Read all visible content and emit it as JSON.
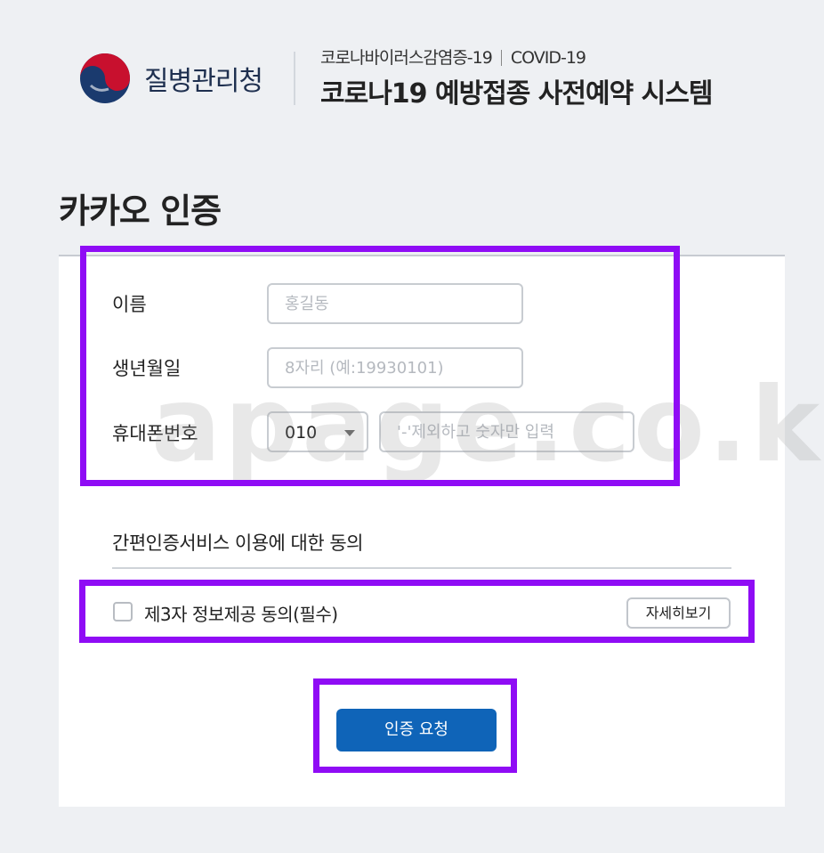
{
  "header": {
    "org_name": "질병관리청",
    "subtitle_left": "코로나바이러스감염증-19",
    "subtitle_right": "COVID-19",
    "title": "코로나19 예방접종 사전예약 시스템"
  },
  "page": {
    "heading": "카카오 인증"
  },
  "form": {
    "name_label": "이름",
    "name_placeholder": "홍길동",
    "birth_label": "생년월일",
    "birth_placeholder": "8자리 (예:19930101)",
    "phone_label": "휴대폰번호",
    "phone_prefix_selected": "010",
    "phone_placeholder": "'-'제외하고 숫자만 입력"
  },
  "watermark": "apage.co.kr",
  "agreement": {
    "title": "간편인증서비스 이용에 대한 동의",
    "item_label": "제3자 정보제공 동의(필수)",
    "detail_button": "자세히보기"
  },
  "actions": {
    "submit_label": "인증 요청"
  },
  "colors": {
    "highlight": "#8f0cf5",
    "primary_button": "#0f64b8",
    "logo_red": "#c8102e",
    "logo_navy": "#1a3a6e"
  },
  "icons": {
    "logo": "kdca-taegeuk-logo",
    "select": "chevron-down-icon",
    "checkbox": "checkbox-unchecked"
  }
}
